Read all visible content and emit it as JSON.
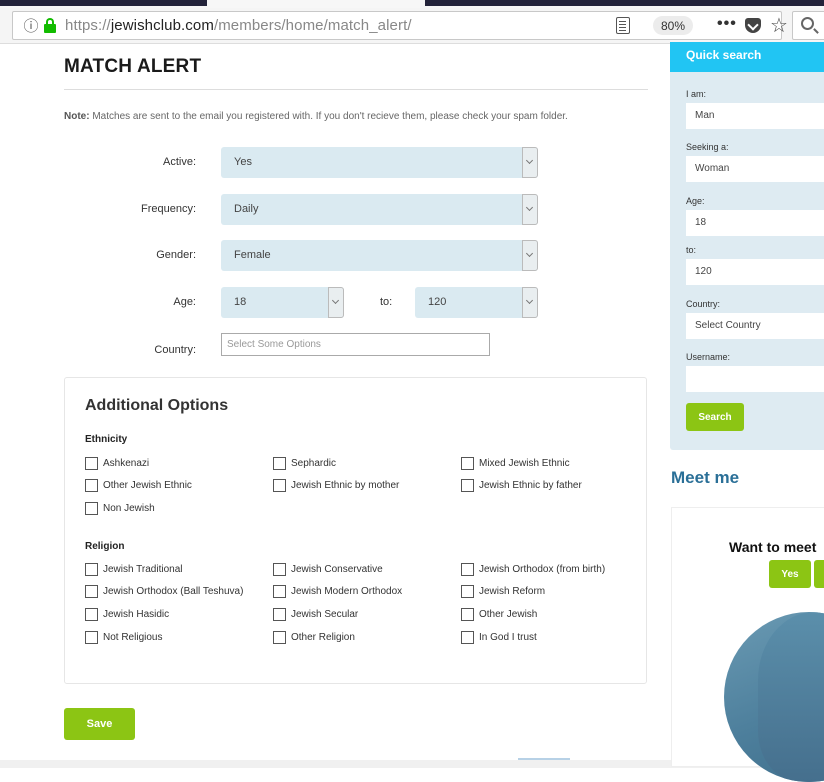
{
  "browser": {
    "url_prefix": "https://",
    "url_domain": "jewishclub.com",
    "url_path": "/members/home/match_alert/",
    "zoom_level": "80%",
    "overflow_menu": "•••",
    "icons": [
      "info-icon",
      "lock-icon",
      "reader-view-icon",
      "pocket-icon",
      "bookmark-star-icon",
      "search-icon"
    ]
  },
  "page": {
    "title": "MATCH ALERT",
    "note_label": "Note:",
    "note_text": " Matches are sent to the email you registered with. If you don't recieve them, please check your spam folder."
  },
  "form": {
    "active": {
      "label": "Active:",
      "value": "Yes"
    },
    "frequency": {
      "label": "Frequency:",
      "value": "Daily"
    },
    "gender": {
      "label": "Gender:",
      "value": "Female"
    },
    "age": {
      "label": "Age:",
      "from": "18",
      "to_label": "to:",
      "to": "120"
    },
    "country": {
      "label": "Country:",
      "placeholder": "Select Some Options"
    }
  },
  "additional": {
    "title": "Additional Options",
    "ethnicity": {
      "title": "Ethnicity",
      "options": [
        "Ashkenazi",
        "Sephardic",
        "Mixed Jewish Ethnic",
        "Other Jewish Ethnic",
        "Jewish Ethnic by mother",
        "Jewish Ethnic by father",
        "Non Jewish"
      ]
    },
    "religion": {
      "title": "Religion",
      "options": [
        "Jewish Traditional",
        "Jewish Conservative",
        "Jewish Orthodox (from birth)",
        "Jewish Orthodox (Ball Teshuva)",
        "Jewish Modern Orthodox",
        "Jewish Reform",
        "Jewish Hasidic",
        "Jewish Secular",
        "Other Jewish",
        "Not Religious",
        "Other Religion",
        "In God I trust"
      ]
    }
  },
  "save_label": "Save",
  "quick_search": {
    "title": "Quick search",
    "i_am_label": "I am:",
    "i_am": "Man",
    "seeking_label": "Seeking a:",
    "seeking": "Woman",
    "age_label": "Age:",
    "age_from": "18",
    "to_label": "to:",
    "age_to": "120",
    "country_label": "Country:",
    "country": "Select Country",
    "username_label": "Username:",
    "username": "",
    "search_label": "Search"
  },
  "meet_me": {
    "title": "Meet me",
    "question": "Want to meet",
    "yes_label": "Yes",
    "no_label": ""
  },
  "colors": {
    "accent_green": "#8cc514",
    "quick_search_header": "#21c5f3",
    "select_bg": "#daeaf1",
    "link_blue": "#2a6f97"
  }
}
